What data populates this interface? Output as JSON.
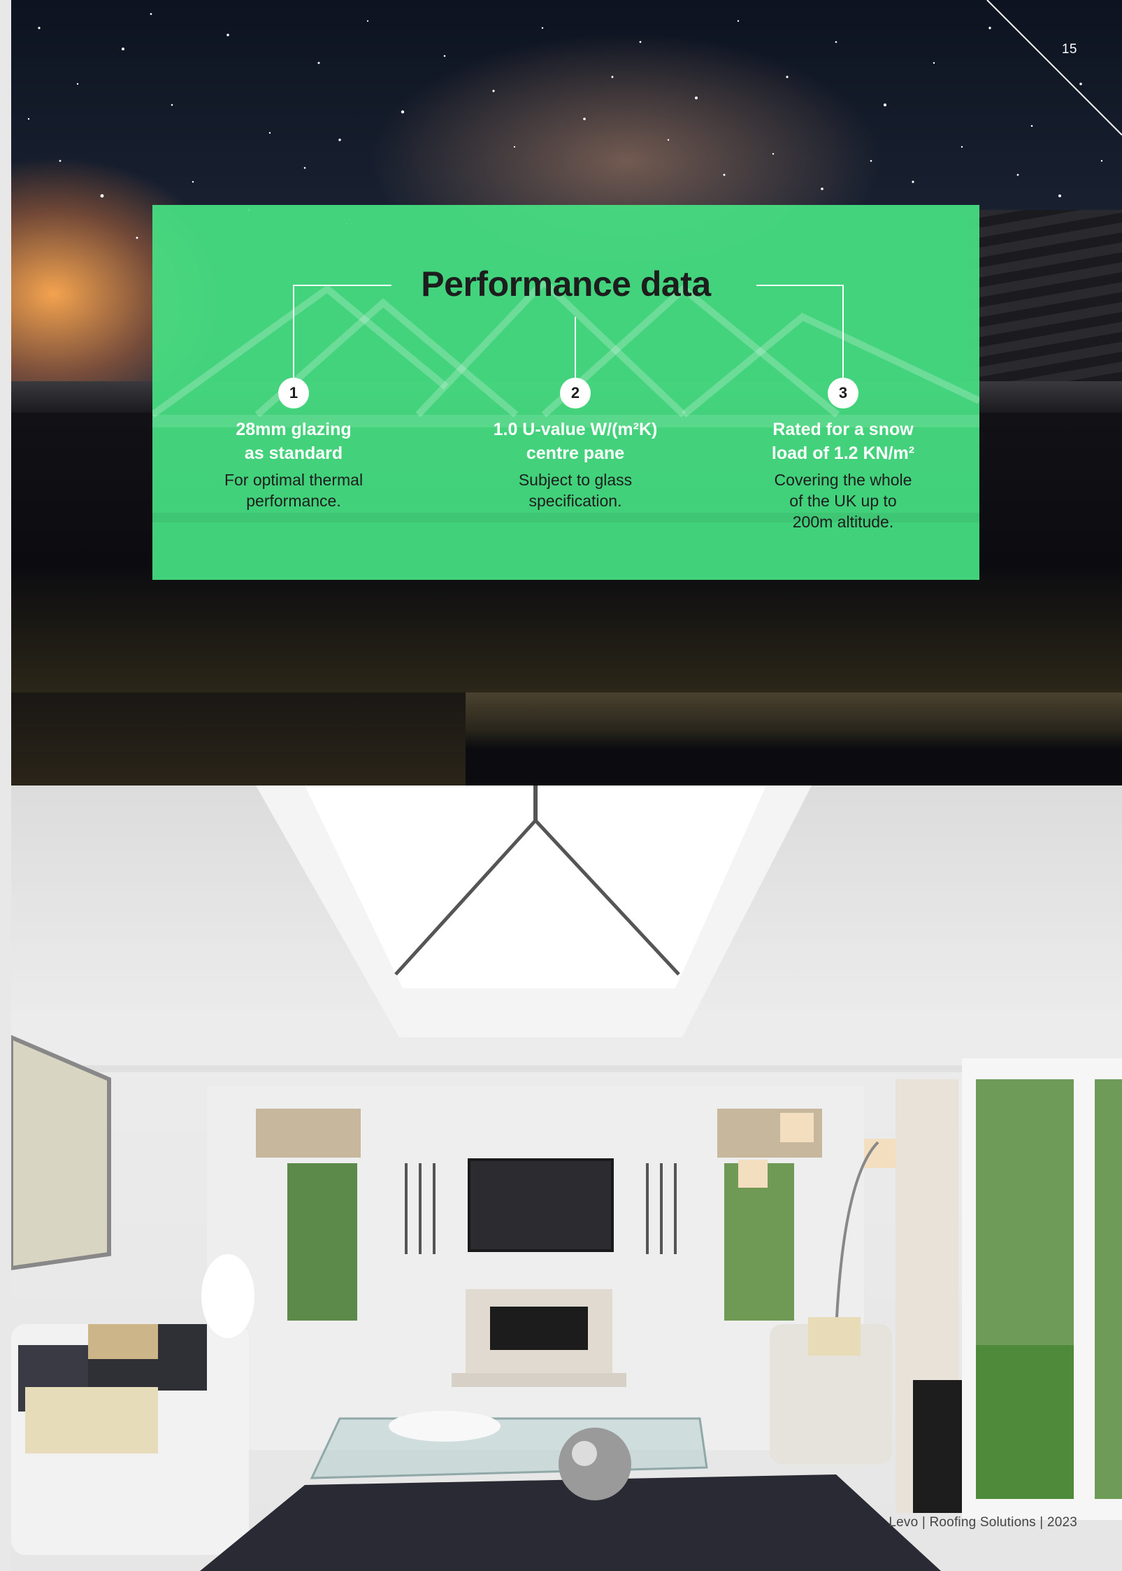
{
  "page": {
    "number": "15"
  },
  "performance": {
    "title": "Performance data",
    "items": [
      {
        "badge": "1",
        "heading_line1": "28mm glazing",
        "heading_line2": "as standard",
        "body_line1": "For optimal thermal",
        "body_line2": "performance.",
        "body_line3": ""
      },
      {
        "badge": "2",
        "heading_line1": "1.0 U-value W/(m²K)",
        "heading_line2": "centre pane",
        "body_line1": "Subject to glass",
        "body_line2": "specification.",
        "body_line3": ""
      },
      {
        "badge": "3",
        "heading_line1": "Rated for a snow",
        "heading_line2": "load of 1.2 KN/m²",
        "body_line1": "Covering the whole",
        "body_line2": "of the UK up to",
        "body_line3": "200m altitude."
      }
    ]
  },
  "footer": {
    "brand": "Levo",
    "product": "Roofing Solutions",
    "year": "2023",
    "separator": " | "
  },
  "colors": {
    "panel_green": "#46de82",
    "title_text": "#1d1d1d",
    "heading_text": "#ffffff"
  }
}
